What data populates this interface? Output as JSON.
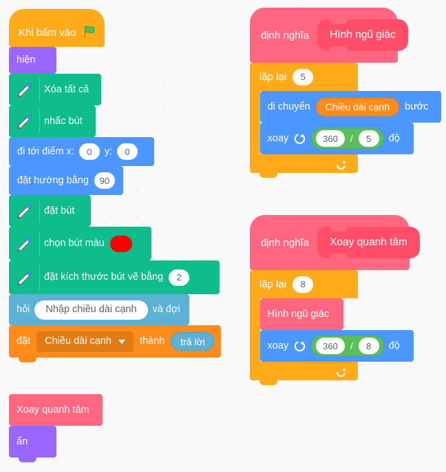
{
  "workspace": {
    "background_color": "#F9F9F9",
    "dot_color": "#E9E9EF"
  },
  "palette": {
    "events": "#FFAB19",
    "looks": "#9966FF",
    "pen": "#0FBD8C",
    "motion": "#4C97FF",
    "sensing": "#5CB1D6",
    "variables": "#FF8C1A",
    "my_blocks": "#FF6680",
    "control": "#FFAB19",
    "operators": "#59C059",
    "pen_color_value": "#FF0000"
  },
  "scripts": {
    "main": {
      "hat": {
        "label": "Khi bấm vào",
        "icon": "green-flag-icon"
      },
      "blocks": [
        {
          "id": "show",
          "label": "hiện"
        },
        {
          "id": "erase-all",
          "label": "Xóa tất cả",
          "icon": "pen-icon"
        },
        {
          "id": "pen-up",
          "label": "nhấc bút",
          "icon": "pen-icon"
        },
        {
          "id": "goto-xy",
          "label": "đi tới điểm x:",
          "label2": "y:",
          "x": "0",
          "y": "0"
        },
        {
          "id": "point-direction",
          "label": "đặt hướng bằng",
          "value": "90"
        },
        {
          "id": "pen-down",
          "label": "đặt bút",
          "icon": "pen-icon"
        },
        {
          "id": "set-pen-color",
          "label": "chọn bút màu",
          "icon": "pen-icon",
          "color": "#FF0000"
        },
        {
          "id": "set-pen-size",
          "label": "đặt kích thước bút vẽ bằng",
          "icon": "pen-icon",
          "value": "2"
        },
        {
          "id": "ask-and-wait",
          "label": "hỏi",
          "question": "Nhập chiều dài cạnh",
          "label2": "và đợi"
        },
        {
          "id": "set-variable",
          "label": "đặt",
          "variable": "Chiều dài cạnh",
          "label2": "thành",
          "value": "trả lời"
        },
        {
          "id": "call-xoay-quanh-tam",
          "label": "Xoay quanh tâm"
        },
        {
          "id": "hide",
          "label": "ẩn"
        }
      ]
    },
    "define_pentagon": {
      "define_label": "định nghĩa",
      "procedure_name": "Hình ngũ giác",
      "repeat": {
        "label": "lặp lại",
        "times": "5",
        "loop_icon": "loop-arrow-icon",
        "body": [
          {
            "id": "move-steps",
            "label": "di chuyển",
            "variable": "Chiều dài cạnh",
            "label2": "bước"
          },
          {
            "id": "turn-right",
            "label": "xoay",
            "icon": "turn-clockwise-icon",
            "operator": "/",
            "operand_a": "360",
            "operand_b": "5",
            "label2": "độ"
          }
        ]
      }
    },
    "define_rotate_center": {
      "define_label": "định nghĩa",
      "procedure_name": "Xoay quanh tâm",
      "repeat": {
        "label": "lặp lại",
        "times": "8",
        "loop_icon": "loop-arrow-icon",
        "body": [
          {
            "id": "call-hinh-ngu-giac",
            "label": "Hình ngũ giác"
          },
          {
            "id": "turn-right",
            "label": "xoay",
            "icon": "turn-clockwise-icon",
            "operator": "/",
            "operand_a": "360",
            "operand_b": "8",
            "label2": "độ"
          }
        ]
      }
    }
  }
}
